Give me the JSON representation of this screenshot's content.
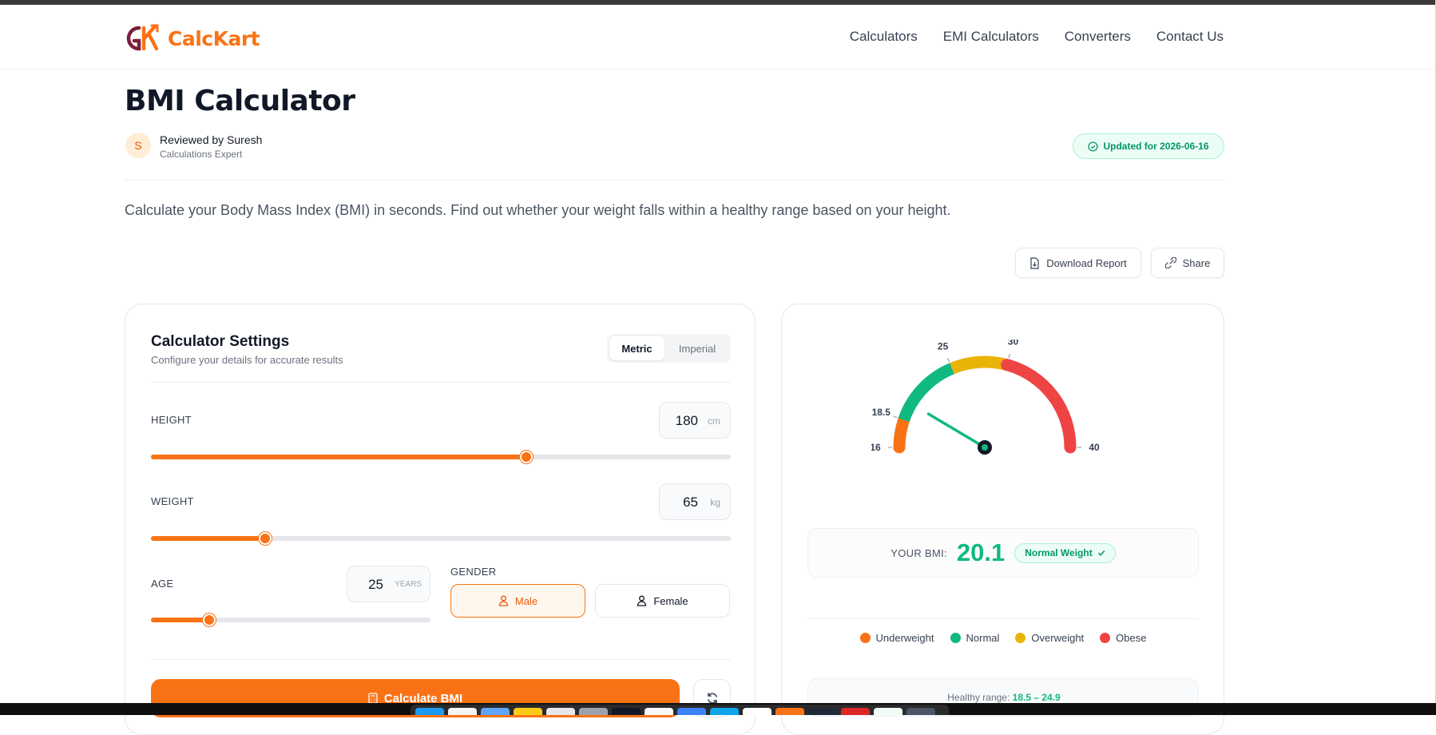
{
  "brand": {
    "name": "CalcKart",
    "logo_letters": "CK"
  },
  "nav": [
    "Calculators",
    "EMI Calculators",
    "Converters",
    "Contact Us"
  ],
  "page": {
    "title": "BMI Calculator",
    "reviewer_initial": "S",
    "reviewer": "Reviewed by Suresh",
    "reviewer_role": "Calculations Expert",
    "updated": "Updated for 2026-06-16",
    "intro": "Calculate your Body Mass Index (BMI) in seconds. Find out whether your weight falls within a healthy range based on your height."
  },
  "actions": {
    "download": "Download Report",
    "share": "Share"
  },
  "settings": {
    "title": "Calculator Settings",
    "subtitle": "Configure your details for accurate results",
    "units": [
      "Metric",
      "Imperial"
    ],
    "selected_unit": "Metric",
    "height": {
      "label": "HEIGHT",
      "value": "180",
      "unit": "cm",
      "slider_fraction": 0.647
    },
    "weight": {
      "label": "WEIGHT",
      "value": "65",
      "unit": "kg",
      "slider_fraction": 0.197
    },
    "age": {
      "label": "AGE",
      "value": "25",
      "unit": "YEARS",
      "slider_fraction": 0.208
    },
    "gender": {
      "label": "GENDER",
      "options": [
        "Male",
        "Female"
      ],
      "selected": "Male"
    },
    "calculate_label": "Calculate BMI"
  },
  "result": {
    "gauge_ticks": [
      "16",
      "18.5",
      "25",
      "30",
      "40"
    ],
    "gauge_min": 16,
    "gauge_max": 40,
    "label": "YOUR BMI:",
    "bmi": "20.1",
    "category": "Normal Weight",
    "legend": [
      {
        "label": "Underweight",
        "color": "#f97316"
      },
      {
        "label": "Normal",
        "color": "#10b981"
      },
      {
        "label": "Overweight",
        "color": "#eab308"
      },
      {
        "label": "Obese",
        "color": "#ef4444"
      }
    ],
    "healthy_label": "Healthy range:",
    "healthy_range": "18.5 – 24.9"
  },
  "colors": {
    "accent": "#f97316",
    "success": "#10b981",
    "warning": "#eab308",
    "danger": "#ef4444"
  }
}
